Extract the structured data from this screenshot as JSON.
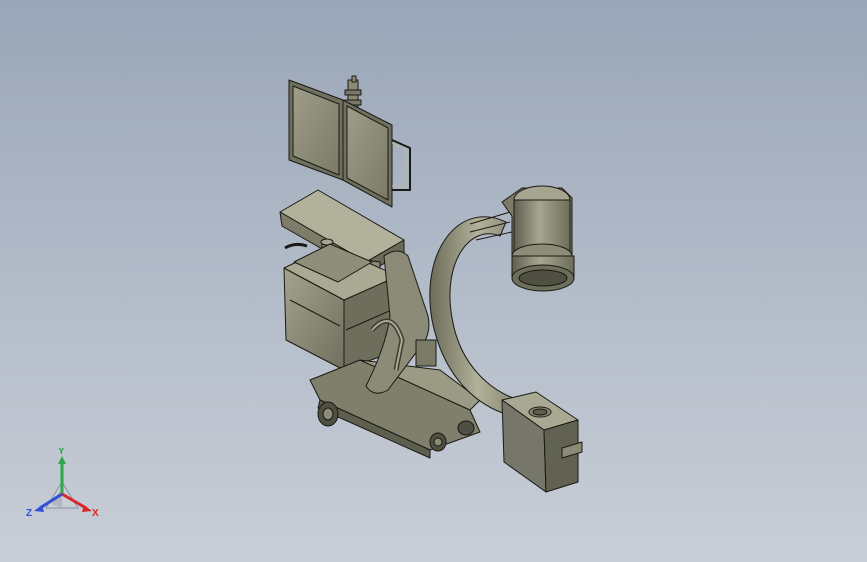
{
  "viewport": {
    "background_top": "#9aa6b8",
    "background_bottom": "#c9ced6",
    "model_color": "#8a8a76",
    "model_shadow": "#5e5e4e",
    "model_highlight": "#b9b9a3",
    "edge_color": "#1a1a14"
  },
  "triad": {
    "x_label": "X",
    "y_label": "Y",
    "z_label": "Z",
    "x_color": "#d9262a",
    "y_color": "#2ea64a",
    "z_color": "#2f4fd6"
  }
}
